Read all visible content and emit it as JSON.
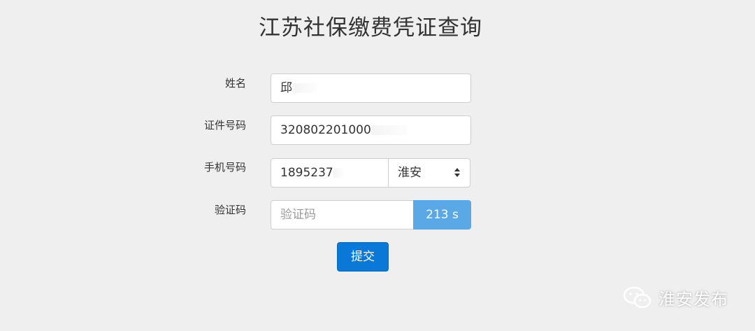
{
  "page": {
    "title": "江苏社保缴费凭证查询"
  },
  "form": {
    "name": {
      "label": "姓名",
      "value": "邱"
    },
    "id_number": {
      "label": "证件号码",
      "value": "320802201000"
    },
    "phone": {
      "label": "手机号码",
      "value": "1895237",
      "city_selected": "淮安"
    },
    "captcha": {
      "label": "验证码",
      "placeholder": "验证码",
      "countdown": "213 s"
    },
    "submit_label": "提交"
  },
  "watermark": {
    "text": "淮安发布",
    "icon": "wechat-icon"
  },
  "colors": {
    "background": "#efefef",
    "countdown_button": "#5aa9e6",
    "submit_button": "#0a78d7"
  }
}
